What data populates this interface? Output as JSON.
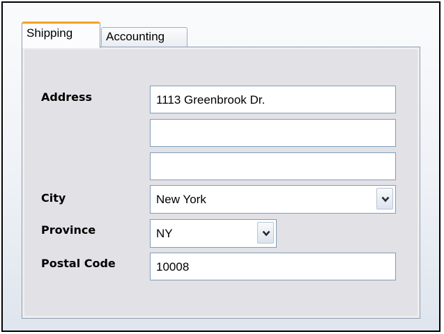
{
  "tabs": [
    {
      "label": "Shipping",
      "active": true
    },
    {
      "label": "Accounting",
      "active": false
    }
  ],
  "form": {
    "address_label": "Address",
    "address_line1": "1113 Greenbrook Dr.",
    "address_line2": "",
    "address_line3": "",
    "city_label": "City",
    "city_value": "New York",
    "province_label": "Province",
    "province_value": "NY",
    "postal_label": "Postal Code",
    "postal_value": "10008"
  },
  "colors": {
    "active_tab_accent": "#f3a02b",
    "panel_background": "#e2e1e5",
    "input_border": "#7f9db9"
  },
  "icons": {
    "dropdown": "chevron-down-icon"
  }
}
